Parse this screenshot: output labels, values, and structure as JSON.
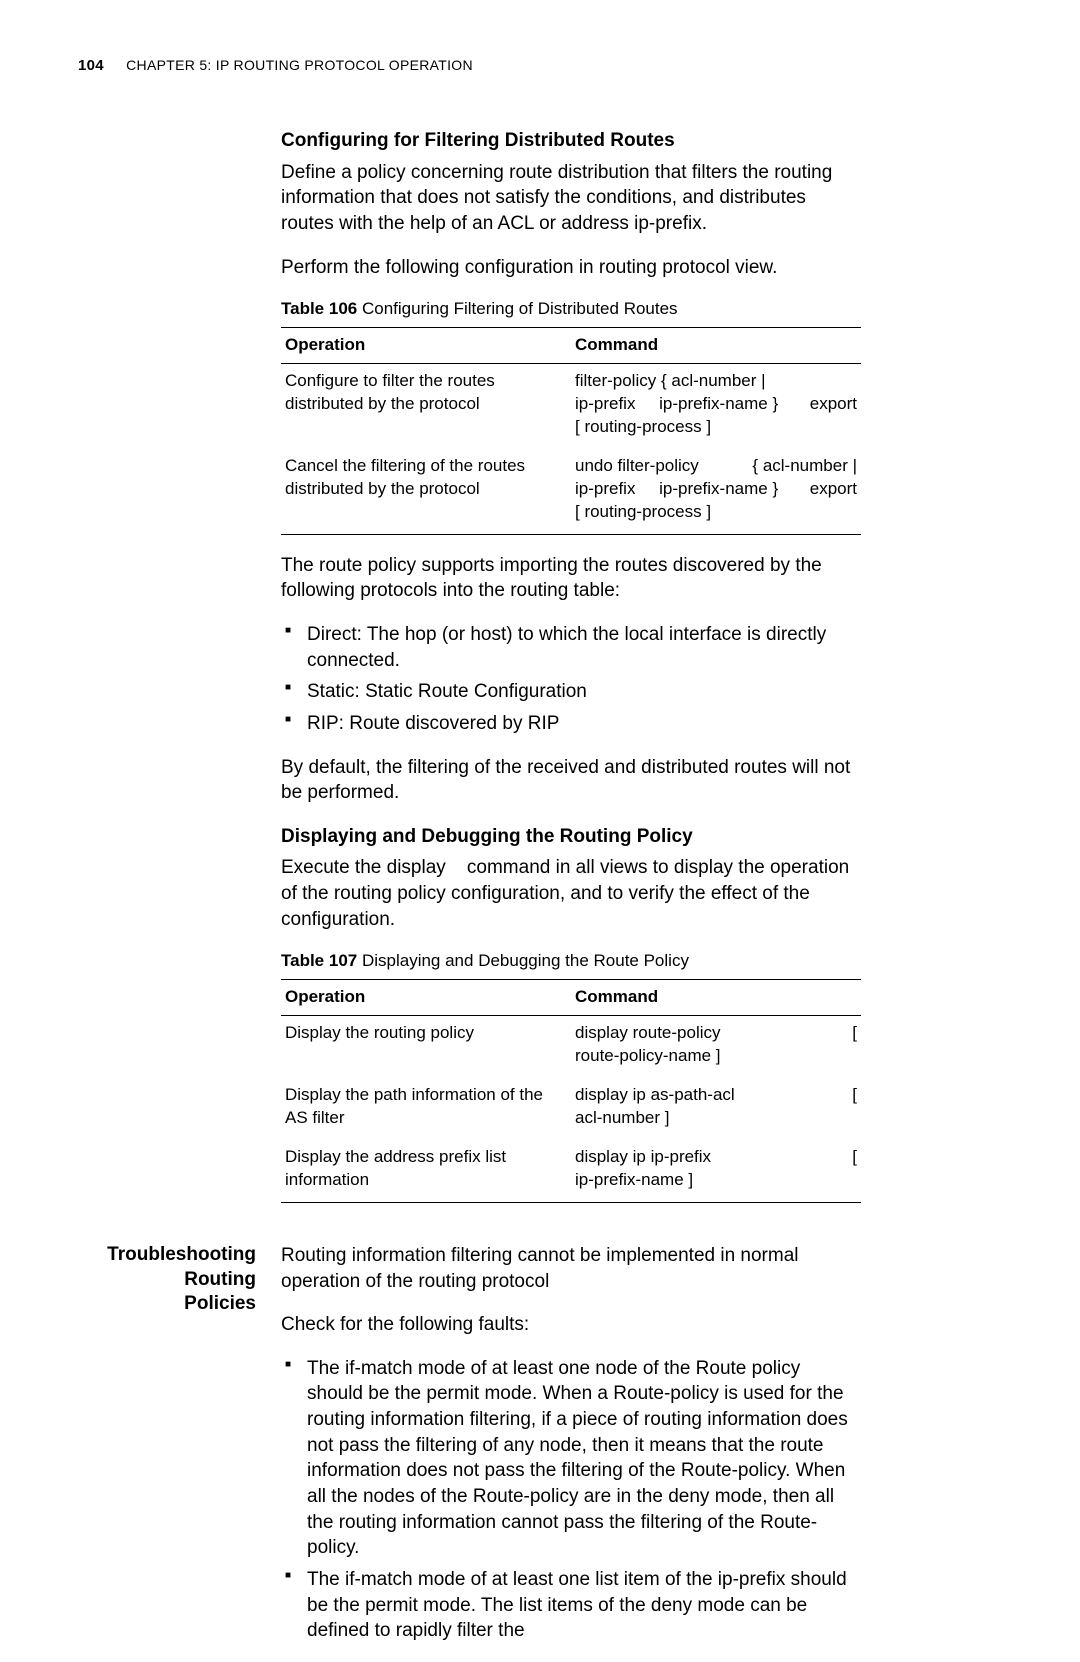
{
  "header": {
    "page_number": "104",
    "chapter_smallcaps_pre": "C",
    "chapter_rest": "HAPTER 5: IP R",
    "chapter_rest2": "OUTING P",
    "chapter_rest3": "ROTOCOL O",
    "chapter_rest4": "PERATION",
    "chapter_full": "CHAPTER 5: IP ROUTING PROTOCOL OPERATION"
  },
  "section1": {
    "title": "Configuring for Filtering Distributed Routes",
    "para1": "Define a policy concerning route distribution that filters the routing information that does not satisfy the conditions, and distributes routes with the help of an ACL or address ip-prefix.",
    "para2": "Perform the following configuration in routing protocol view.",
    "table_caption_b": "Table 106",
    "table_caption_rest": "   Configuring Filtering of Distributed Routes",
    "th1": "Operation",
    "th2": "Command",
    "r1c1": "Configure to filter the routes distributed by the protocol",
    "r1c2_l1a": "filter-policy { acl-number |",
    "r1c2_l2a": "ip-prefix",
    "r1c2_l2b": "ip-prefix-name }",
    "r1c2_l2c": "export",
    "r1c2_l3": "[ routing-process ]",
    "r2c1": "Cancel the filtering of the routes distributed by the protocol",
    "r2c2_l1a": "undo filter-policy",
    "r2c2_l1b": "{ acl-number |",
    "r2c2_l2a": "ip-prefix",
    "r2c2_l2b": "ip-prefix-name }",
    "r2c2_l2c": "export",
    "r2c2_l3": "[ routing-process ]",
    "para3": "The route policy supports importing the routes discovered by the following protocols into the routing table:",
    "li1": "Direct: The hop (or host) to which the local interface is directly connected.",
    "li2": "Static: Static Route Configuration",
    "li3": "RIP: Route discovered by RIP",
    "para4": "By default, the filtering of the received and distributed routes will not be performed."
  },
  "section2": {
    "title": "Displaying and Debugging the Routing Policy",
    "para1a": "Execute the ",
    "para1_cmd": "display",
    "para1b": " command in all views to display the operation of the routing policy configuration, and to verify the effect of the configuration.",
    "table_caption_b": "Table 107",
    "table_caption_rest": "   Displaying and Debugging the Route Policy",
    "th1": "Operation",
    "th2": "Command",
    "r1c1": "Display the routing policy",
    "r1c2a": "display route-policy",
    "r1c2b": "[",
    "r1c2c": "route-policy-name ]",
    "r2c1": "Display the path information of the AS filter",
    "r2c2a": "display ip as-path-acl",
    "r2c2b": "[",
    "r2c2c": "acl-number ]",
    "r3c1": "Display the address prefix list information",
    "r3c2a": "display ip ip-prefix",
    "r3c2b": "[",
    "r3c2c": "ip-prefix-name ]"
  },
  "section3": {
    "side_label_l1": "Troubleshooting Routing",
    "side_label_l2": "Policies",
    "para1": "Routing information filtering cannot be implemented in normal operation of the routing protocol",
    "para2": "Check for the following faults:",
    "li1": "The if-match mode of at least one node of the Route policy should be the permit mode. When a Route-policy is used for the routing information filtering, if a piece of routing information does not pass the filtering of any node, then it means that the route information does not pass the filtering of the Route-policy. When all the nodes of the Route-policy are in the deny mode, then all the routing information cannot pass the filtering of the Route-policy.",
    "li2": "The if-match mode of at least one list item of the ip-prefix should be the permit mode. The list items of the deny mode can be defined to rapidly filter the"
  }
}
